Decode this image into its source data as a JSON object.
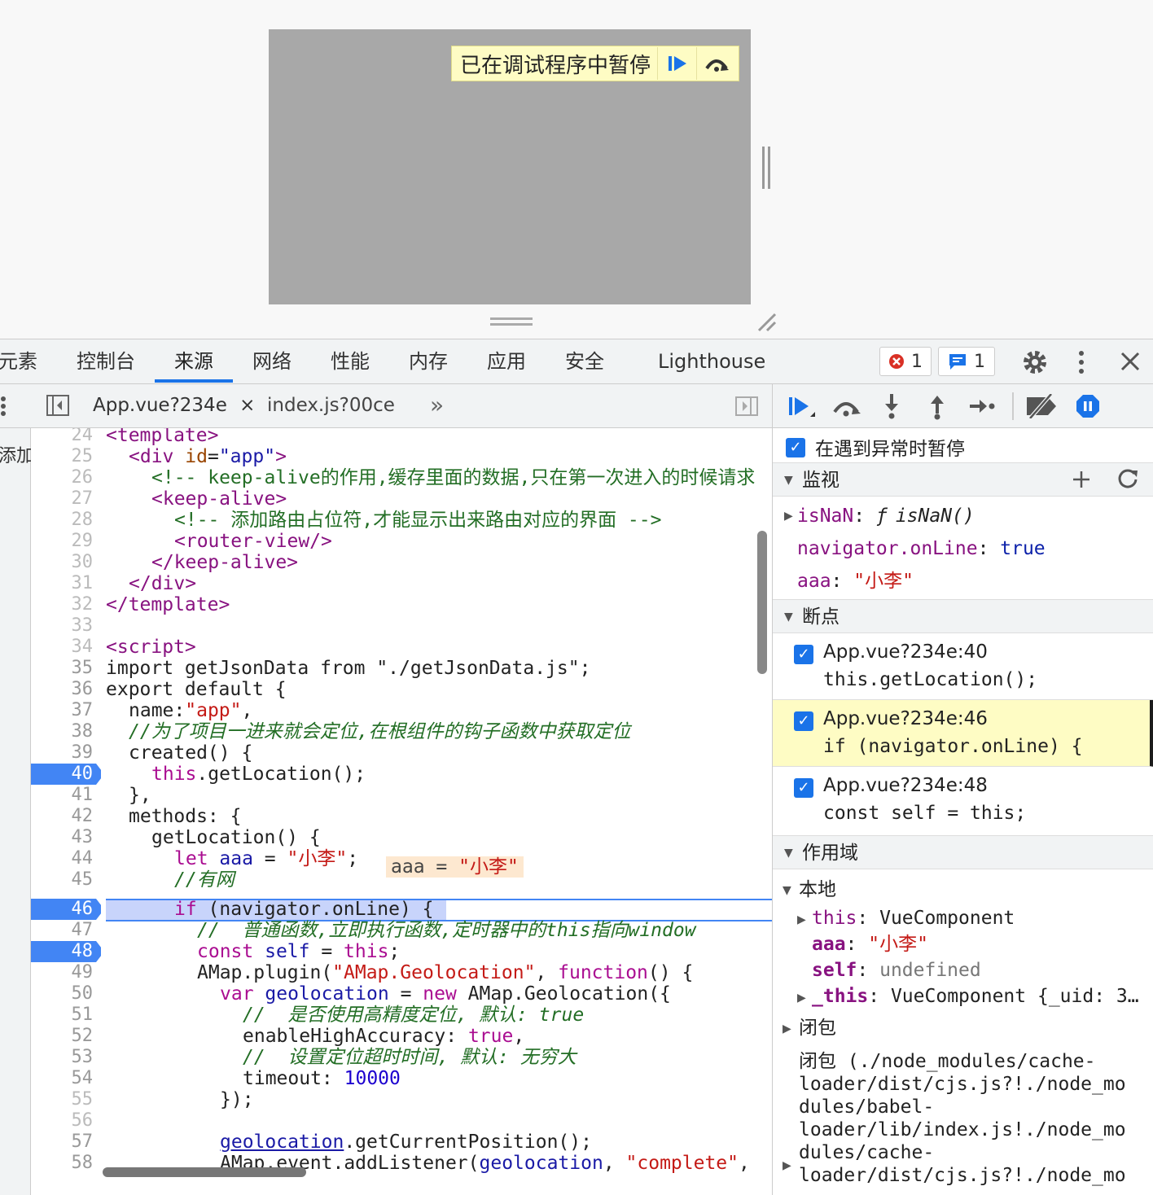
{
  "overlay": {
    "paused_message": "已在调试程序中暂停"
  },
  "devtools_tabs": [
    "元素",
    "控制台",
    "来源",
    "网络",
    "性能",
    "内存",
    "应用",
    "安全",
    "Lighthouse"
  ],
  "active_tab": "来源",
  "badges": {
    "errors": "1",
    "messages": "1"
  },
  "file_tabs": [
    {
      "label": "App.vue?234e",
      "close": "×"
    },
    {
      "label": "index.js?00ce"
    }
  ],
  "file_tabs_more": "»",
  "left_strip_text": "添加",
  "code": {
    "lines": [
      {
        "n": "24"
      },
      {
        "n": "25"
      },
      {
        "n": "26"
      },
      {
        "n": "27"
      },
      {
        "n": "28"
      },
      {
        "n": "29"
      },
      {
        "n": "30"
      },
      {
        "n": "31"
      },
      {
        "n": "32"
      },
      {
        "n": "33"
      },
      {
        "n": "34"
      },
      {
        "n": "35"
      },
      {
        "n": "36"
      },
      {
        "n": "37"
      },
      {
        "n": "38"
      },
      {
        "n": "39"
      },
      {
        "n": "40"
      },
      {
        "n": "41"
      },
      {
        "n": "42"
      },
      {
        "n": "43"
      },
      {
        "n": "44"
      },
      {
        "n": "45"
      },
      {
        "n": "46"
      },
      {
        "n": "47"
      },
      {
        "n": "48"
      },
      {
        "n": "49"
      },
      {
        "n": "50"
      },
      {
        "n": "51"
      },
      {
        "n": "52"
      },
      {
        "n": "53"
      },
      {
        "n": "54"
      },
      {
        "n": "55"
      },
      {
        "n": "56"
      },
      {
        "n": "57"
      },
      {
        "n": "58"
      }
    ],
    "text": {
      "l24": "<template>",
      "l25a": "<div ",
      "l25b": "id",
      "l25c": "=",
      "l25d": "\"app\"",
      "l25e": ">",
      "l26": "<!-- keep-alive的作用,缓存里面的数据,只在第一次进入的时候请求",
      "l27": "<keep-alive>",
      "l28": "<!-- 添加路由占位符,才能显示出来路由对应的界面 -->",
      "l29": "<router-view/>",
      "l30": "</keep-alive>",
      "l31": "</div>",
      "l32": "</template>",
      "l34": "<script>",
      "l35": "import getJsonData from \"./getJsonData.js\";",
      "l36": "export default {",
      "l37a": "name:",
      "l37b": "\"app\"",
      "l37c": ",",
      "l38": "//为了项目一进来就会定位,在根组件的钩子函数中获取定位",
      "l39": "created() {",
      "l40a": "this",
      "l40b": ".getLocation();",
      "l41": "},",
      "l42": "methods: {",
      "l43": "getLocation() {",
      "l44a": "let ",
      "l44b": "aaa",
      "l44c": " = ",
      "l44d": "\"小李\"",
      "l44e": ";",
      "l44_inline_a": "aaa = ",
      "l44_inline_b": "\"小李\"",
      "l45": "//有网",
      "l46a": "if",
      "l46b": " (navigator.onLine) {",
      "l47": "//  普通函数,立即执行函数,定时器中的this指向window",
      "l48a": "const ",
      "l48b": "self",
      "l48c": " = ",
      "l48d": "this",
      "l48e": ";",
      "l49a": "AMap.plugin(",
      "l49b": "\"AMap.Geolocation\"",
      "l49c": ", ",
      "l49d": "function",
      "l49e": "() {",
      "l50a": "var ",
      "l50b": "geolocation",
      "l50c": " = ",
      "l50d": "new",
      "l50e": " AMap.Geolocation({",
      "l51": "//  是否使用高精度定位, 默认: true",
      "l52a": "enableHighAccuracy: ",
      "l52b": "true",
      "l52c": ",",
      "l53": "//  设置定位超时时间, 默认: 无穷大",
      "l54a": "timeout: ",
      "l54b": "10000",
      "l55": "});",
      "l57a": "geolocation",
      "l57b": ".getCurrentPosition();",
      "l58a": "AMap.event.addListener(",
      "l58b": "geolocation",
      "l58c": ", ",
      "l58d": "\"complete\"",
      "l58e": ","
    }
  },
  "right_panel": {
    "pause_on_exceptions": "在遇到异常时暂停",
    "watch_header": "监视",
    "watch": [
      {
        "name": "isNaN",
        "sep": ": ",
        "f": "ƒ",
        "value": "isNaN()"
      },
      {
        "name": "navigator.onLine",
        "sep": ": ",
        "value": "true"
      },
      {
        "name": "aaa",
        "sep": ": ",
        "value": "\"小李\""
      }
    ],
    "breakpoints_header": "断点",
    "breakpoints": [
      {
        "location": "App.vue?234e:40",
        "code": "this.getLocation();"
      },
      {
        "location": "App.vue?234e:46",
        "code": "if (navigator.onLine) {"
      },
      {
        "location": "App.vue?234e:48",
        "code": "const self = this;"
      }
    ],
    "scope_header": "作用域",
    "local_header": "本地",
    "scope_local": [
      {
        "name": "this",
        "sep": ": ",
        "value": "VueComponent"
      },
      {
        "name": "aaa",
        "sep": ": ",
        "value": "\"小李\""
      },
      {
        "name": "self",
        "sep": ": ",
        "value": "undefined"
      },
      {
        "name": "_this",
        "sep": ": ",
        "value": "VueComponent {_uid: 3…"
      }
    ],
    "closure_header": "闭包",
    "closure_text": [
      "闭包 (./node_modules/cache-",
      "loader/dist/cjs.js?!./node_mo",
      "dules/babel-",
      "loader/lib/index.js!./node_mo",
      "dules/cache-",
      "loader/dist/cjs.js?!./node_mo"
    ]
  },
  "colors": {
    "accent": "#1a73e8",
    "breakpoint": "#4285f4",
    "paused_bg": "#fefcc4"
  }
}
